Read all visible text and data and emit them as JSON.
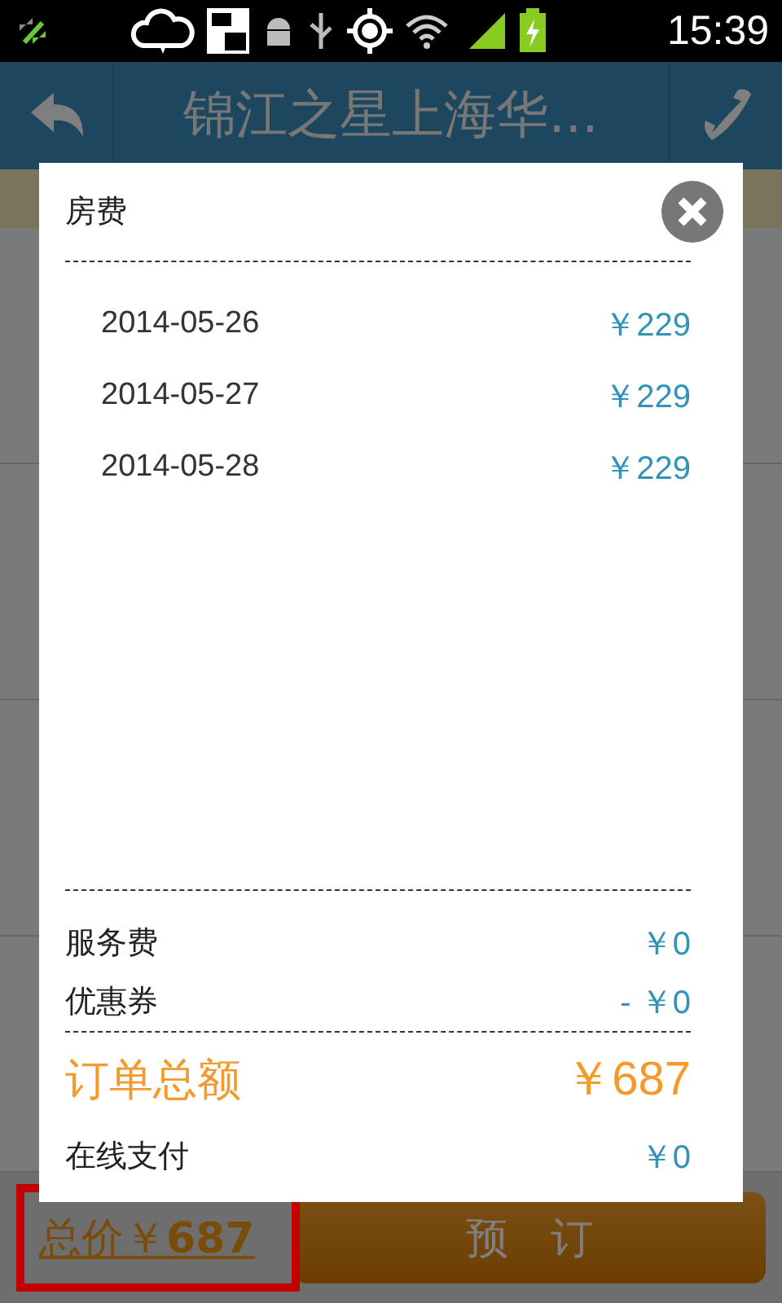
{
  "status_bar": {
    "time": "15:39"
  },
  "header": {
    "title": "锦江之星上海华..."
  },
  "dialog": {
    "title": "房费",
    "nights": [
      {
        "date": "2014-05-26",
        "price": "￥229"
      },
      {
        "date": "2014-05-27",
        "price": "￥229"
      },
      {
        "date": "2014-05-28",
        "price": "￥229"
      }
    ],
    "fees": [
      {
        "label": "服务费",
        "value": "￥0"
      },
      {
        "label": "优惠券",
        "value": "- ￥0"
      }
    ],
    "total": {
      "label": "订单总额",
      "value": "￥687"
    },
    "online_payment": {
      "label": "在线支付",
      "value": "￥0"
    }
  },
  "bottom_bar": {
    "total_price": "总价￥**687**",
    "book_button": "预　订"
  }
}
